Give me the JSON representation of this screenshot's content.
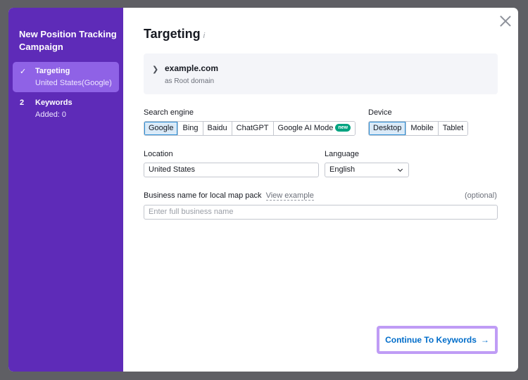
{
  "sidebar": {
    "title": "New Position Tracking Campaign",
    "steps": [
      {
        "marker": "✓",
        "name": "Targeting",
        "sub": "United States(Google)"
      },
      {
        "marker": "2",
        "name": "Keywords",
        "sub": "Added: 0"
      }
    ]
  },
  "main": {
    "title": "Targeting",
    "info_icon": "i",
    "domain": {
      "name": "example.com",
      "type": "as Root domain"
    },
    "search_engine": {
      "label": "Search engine",
      "options": [
        "Google",
        "Bing",
        "Baidu",
        "ChatGPT",
        "Google AI Mode"
      ],
      "selected": "Google",
      "new_badge": "new"
    },
    "device": {
      "label": "Device",
      "options": [
        "Desktop",
        "Mobile",
        "Tablet"
      ],
      "selected": "Desktop"
    },
    "location": {
      "label": "Location",
      "value": "United States"
    },
    "language": {
      "label": "Language",
      "value": "English"
    },
    "business": {
      "label": "Business name for local map pack",
      "link": "View example",
      "optional": "(optional)",
      "placeholder": "Enter full business name"
    },
    "cta": {
      "label": "Continue To Keywords",
      "arrow": "→"
    }
  },
  "colors": {
    "sidebar": "#5e2bb8",
    "active_step": "#8f62e6",
    "selected_segment": "#daeaf8",
    "cta_text": "#006dca",
    "cta_highlight": "#bf9cf5",
    "badge": "#00a380"
  },
  "icons": [
    "close-icon",
    "check-icon",
    "chevron-right-icon",
    "info-icon",
    "chevron-down-icon",
    "arrow-right-icon"
  ]
}
